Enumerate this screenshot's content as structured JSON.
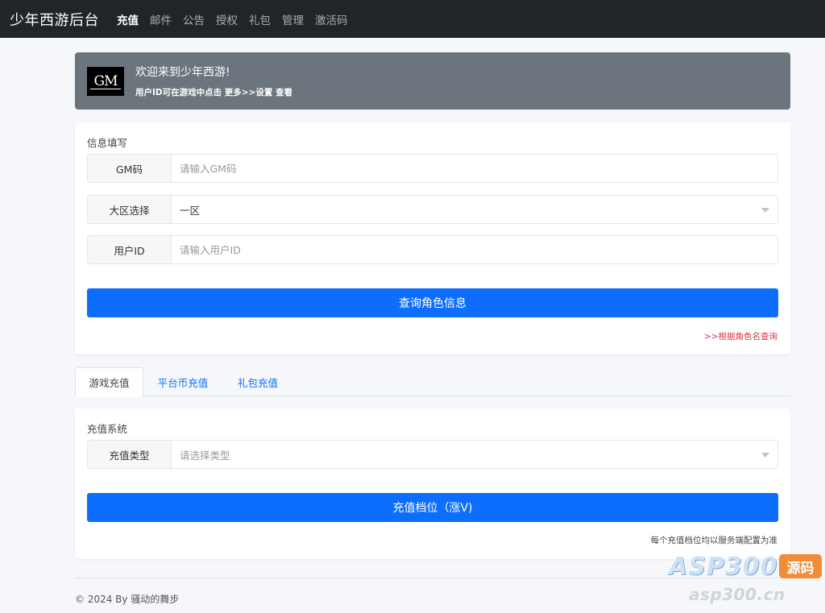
{
  "nav": {
    "brand": "少年西游后台",
    "items": [
      {
        "label": "充值",
        "active": true
      },
      {
        "label": "邮件"
      },
      {
        "label": "公告"
      },
      {
        "label": "授权"
      },
      {
        "label": "礼包"
      },
      {
        "label": "管理"
      },
      {
        "label": "激活码"
      }
    ]
  },
  "welcome": {
    "logo_text": "GM",
    "title": "欢迎来到少年西游!",
    "subtitle": "用户ID可在游戏中点击 更多>>设置 查看"
  },
  "info_form": {
    "title": "信息填写",
    "gm_code": {
      "label": "GM码",
      "placeholder": "请输入GM码",
      "value": ""
    },
    "region": {
      "label": "大区选择",
      "value": "一区"
    },
    "user_id": {
      "label": "用户ID",
      "placeholder": "请输入用户ID",
      "value": ""
    },
    "query_button": "查询角色信息",
    "query_by_name_link": ">>根据角色名查询"
  },
  "tabs": [
    {
      "label": "游戏充值",
      "active": true
    },
    {
      "label": "平台币充值"
    },
    {
      "label": "礼包充值"
    }
  ],
  "recharge": {
    "title": "充值系统",
    "type": {
      "label": "充值类型",
      "placeholder": "请选择类型"
    },
    "tier_button": "充值档位（涨V)",
    "note": "每个充值档位均以服务端配置为准"
  },
  "footer": {
    "text": "© 2024 By 骚动的舞步"
  },
  "watermark": {
    "brand": "ASP300",
    "badge": "源码",
    "domain": "asp300.cn"
  },
  "colors": {
    "primary": "#0d6efd",
    "navbar": "#212529",
    "welcome_bg": "#6c757d",
    "link_red": "#dc3545"
  }
}
